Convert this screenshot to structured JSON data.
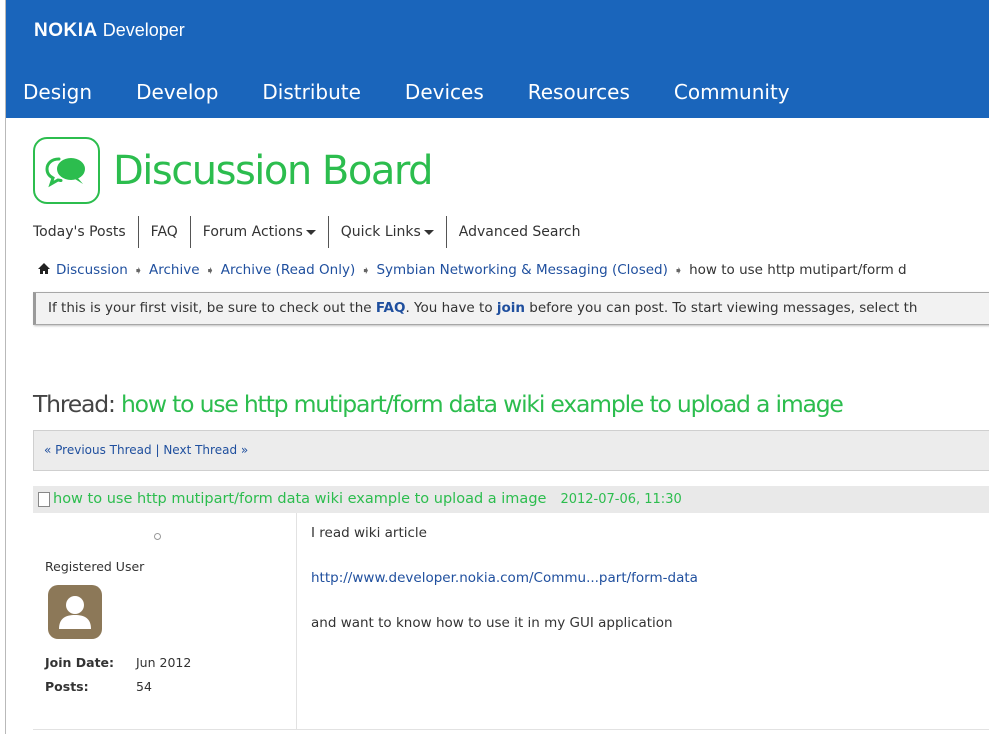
{
  "brand": {
    "logo": "NOKIA",
    "name": "Developer"
  },
  "main_nav": [
    "Design",
    "Develop",
    "Distribute",
    "Devices",
    "Resources",
    "Community"
  ],
  "main_nav_active": "Community",
  "board": {
    "title": "Discussion Board",
    "icon": "speech-bubbles-icon"
  },
  "sub_nav": {
    "todays_posts": "Today's Posts",
    "faq": "FAQ",
    "forum_actions": "Forum Actions",
    "quick_links": "Quick Links",
    "advanced_search": "Advanced Search"
  },
  "breadcrumb": {
    "home_icon": "home-icon",
    "items": [
      "Discussion",
      "Archive",
      "Archive (Read Only)",
      "Symbian Networking & Messaging (Closed)"
    ],
    "current": "how to use http mutipart/form d"
  },
  "notice": {
    "text1": "If this is your first visit, be sure to check out the ",
    "faq_link": "FAQ",
    "text2": ". You have to ",
    "join_link": "join",
    "text3": " before you can post. To start viewing messages, select th"
  },
  "thread": {
    "label": "Thread: ",
    "title": "how to use http mutipart/form data wiki example to upload a image",
    "prev": "« Previous Thread",
    "sep": " | ",
    "next": "Next Thread »"
  },
  "post": {
    "title": "how to use http mutipart/form data wiki example to upload a image",
    "date": "2012-07-06, 11:30",
    "user": {
      "title": "Registered User",
      "join_label": "Join Date:",
      "join_value": "Jun 2012",
      "posts_label": "Posts:",
      "posts_value": "54"
    },
    "body": {
      "line1": "I read wiki article",
      "link": "http://www.developer.nokia.com/Commu...part/form-data",
      "line3": "and want to know how to use it in my GUI application"
    }
  },
  "colors": {
    "header_blue": "#1a65bb",
    "accent_green": "#2cbd4e",
    "link_blue": "#1f4f9e"
  }
}
